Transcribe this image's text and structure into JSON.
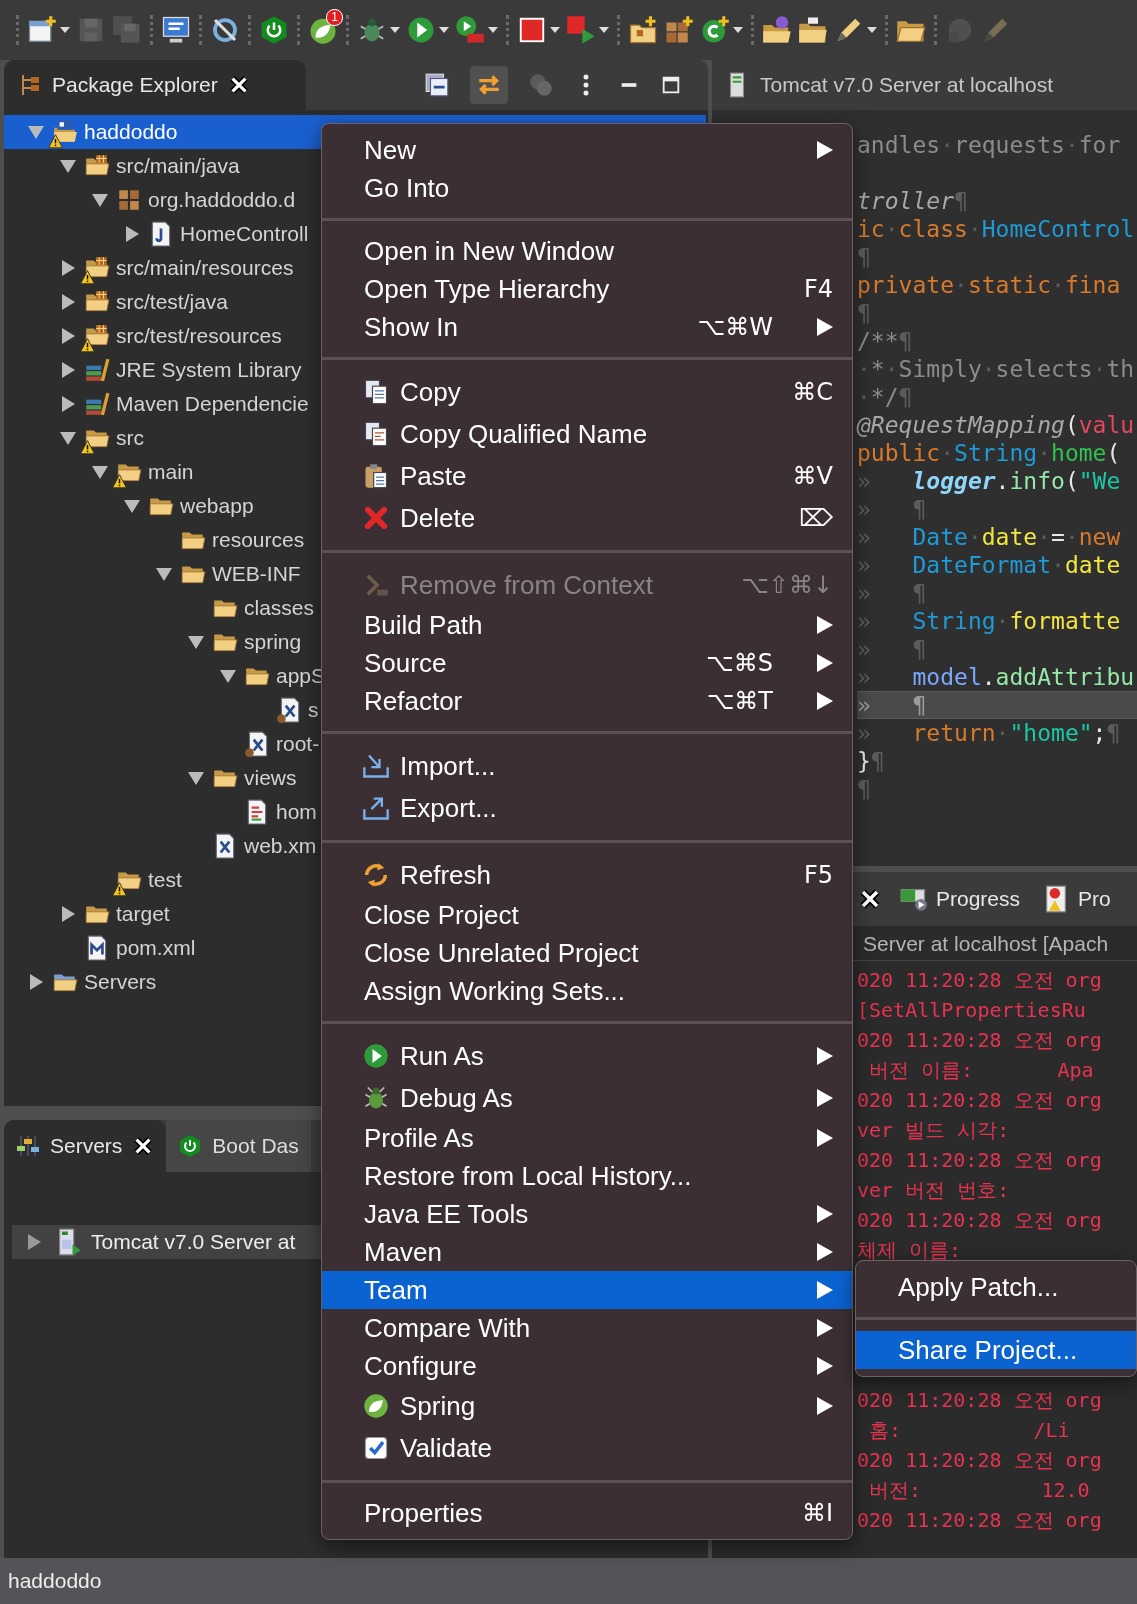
{
  "toolbar": [
    [
      {
        "kind": "new",
        "dropdown": true,
        "disabled": false
      },
      {
        "kind": "save",
        "dropdown": false,
        "disabled": true
      },
      {
        "kind": "save-all",
        "dropdown": false,
        "disabled": true
      }
    ],
    [
      {
        "kind": "monitor",
        "dropdown": false,
        "disabled": false
      }
    ],
    [
      {
        "kind": "skip",
        "dropdown": false,
        "disabled": false
      }
    ],
    [
      {
        "kind": "power",
        "dropdown": false,
        "disabled": false
      }
    ],
    [
      {
        "kind": "leaf",
        "dropdown": false,
        "disabled": false,
        "badge": "1"
      }
    ],
    [
      {
        "kind": "bug",
        "dropdown": true,
        "disabled": false
      },
      {
        "kind": "run",
        "dropdown": true,
        "disabled": false
      },
      {
        "kind": "run-server",
        "dropdown": true,
        "disabled": false
      }
    ],
    [
      {
        "kind": "stop",
        "dropdown": true,
        "disabled": false
      },
      {
        "kind": "stop-arrow",
        "dropdown": true,
        "disabled": false
      }
    ],
    [
      {
        "kind": "new-package",
        "dropdown": false,
        "disabled": false
      },
      {
        "kind": "new-grid",
        "dropdown": false,
        "disabled": false
      },
      {
        "kind": "new-class",
        "dropdown": true,
        "disabled": false
      }
    ],
    [
      {
        "kind": "folder-ball",
        "dropdown": false,
        "disabled": false
      },
      {
        "kind": "briefcase",
        "dropdown": false,
        "disabled": false
      },
      {
        "kind": "pencil",
        "dropdown": true,
        "disabled": false
      }
    ],
    [
      {
        "kind": "folder-open",
        "dropdown": false,
        "disabled": false
      }
    ],
    [
      {
        "kind": "grey-blob",
        "dropdown": false,
        "disabled": true
      },
      {
        "kind": "pencil",
        "dropdown": false,
        "disabled": true
      }
    ]
  ],
  "package_explorer": {
    "title": "Package Explorer",
    "tree": [
      {
        "label": "haddoddo",
        "kind": "project",
        "warning": true,
        "selected": true,
        "expanded": true,
        "children": [
          {
            "label": "src/main/java",
            "kind": "source-folder",
            "warning": false,
            "selected": false,
            "expanded": true,
            "children": [
              {
                "label": "org.haddoddo.d",
                "kind": "package",
                "warning": false,
                "selected": false,
                "expanded": true,
                "children": [
                  {
                    "label": "HomeControll",
                    "kind": "java",
                    "warning": false,
                    "selected": false,
                    "expanded": false
                  }
                ]
              }
            ]
          },
          {
            "label": "src/main/resources",
            "kind": "source-folder",
            "warning": true,
            "selected": false,
            "expanded": false
          },
          {
            "label": "src/test/java",
            "kind": "source-folder",
            "warning": false,
            "selected": false,
            "expanded": false
          },
          {
            "label": "src/test/resources",
            "kind": "source-folder",
            "warning": true,
            "selected": false,
            "expanded": false
          },
          {
            "label": "JRE System Library",
            "kind": "library",
            "warning": false,
            "selected": false,
            "expanded": false
          },
          {
            "label": "Maven Dependencie",
            "kind": "library",
            "warning": false,
            "selected": false,
            "expanded": false
          },
          {
            "label": "src",
            "kind": "folder",
            "warning": true,
            "selected": false,
            "expanded": true,
            "children": [
              {
                "label": "main",
                "kind": "folder",
                "warning": true,
                "selected": false,
                "expanded": true,
                "children": [
                  {
                    "label": "webapp",
                    "kind": "folder",
                    "warning": false,
                    "selected": false,
                    "expanded": true,
                    "children": [
                      {
                        "label": "resources",
                        "kind": "folder",
                        "warning": false,
                        "selected": false
                      },
                      {
                        "label": "WEB-INF",
                        "kind": "folder",
                        "warning": false,
                        "selected": false,
                        "expanded": true,
                        "children": [
                          {
                            "label": "classes",
                            "kind": "folder",
                            "warning": false,
                            "selected": false
                          },
                          {
                            "label": "spring",
                            "kind": "folder",
                            "warning": false,
                            "selected": false,
                            "expanded": true,
                            "children": [
                              {
                                "label": "appS",
                                "kind": "folder",
                                "warning": false,
                                "selected": false,
                                "expanded": true,
                                "children": [
                                  {
                                    "label": "s",
                                    "kind": "xml-spring",
                                    "warning": false,
                                    "selected": false
                                  }
                                ]
                              },
                              {
                                "label": "root-",
                                "kind": "xml-spring",
                                "warning": false,
                                "selected": false
                              }
                            ]
                          },
                          {
                            "label": "views",
                            "kind": "folder",
                            "warning": false,
                            "selected": false,
                            "expanded": true,
                            "children": [
                              {
                                "label": "hom",
                                "kind": "jsp",
                                "warning": false,
                                "selected": false
                              }
                            ]
                          },
                          {
                            "label": "web.xm",
                            "kind": "xml",
                            "warning": false,
                            "selected": false
                          }
                        ]
                      }
                    ]
                  }
                ]
              },
              {
                "label": "test",
                "kind": "folder",
                "warning": true,
                "selected": false
              }
            ]
          },
          {
            "label": "target",
            "kind": "folder",
            "warning": false,
            "selected": false,
            "expanded": false
          },
          {
            "label": "pom.xml",
            "kind": "maven",
            "warning": false,
            "selected": false
          }
        ]
      },
      {
        "label": "Servers",
        "kind": "server-folder",
        "warning": false,
        "selected": false,
        "expanded": false
      }
    ]
  },
  "editor": {
    "tab": "Tomcat v7.0 Server at localhost",
    "lines": [
      {
        "current": false,
        "tokens": [
          {
            "text": "andles·requests·for",
            "kind": "comment"
          }
        ]
      },
      {
        "current": false,
        "tokens": [
          {
            "text": "troller",
            "kind": "annotation"
          },
          {
            "text": "¶",
            "kind": "plain"
          }
        ]
      },
      {
        "current": false,
        "tokens": [
          {
            "text": "ic·class·",
            "kind": "keyword"
          },
          {
            "text": "HomeControl",
            "kind": "type"
          }
        ]
      },
      {
        "current": false,
        "tokens": [
          {
            "text": "¶",
            "kind": "plain"
          }
        ]
      },
      {
        "current": false,
        "tokens": [
          {
            "text": "private·static·fina",
            "kind": "keyword"
          }
        ]
      },
      {
        "current": false,
        "tokens": [
          {
            "text": "¶",
            "kind": "plain"
          }
        ]
      },
      {
        "current": false,
        "tokens": [
          {
            "text": "/**¶",
            "kind": "comment"
          }
        ]
      },
      {
        "current": false,
        "tokens": [
          {
            "text": "·*·Simply·selects·th",
            "kind": "comment"
          }
        ]
      },
      {
        "current": false,
        "tokens": [
          {
            "text": "·*/¶",
            "kind": "comment"
          }
        ]
      },
      {
        "current": false,
        "tokens": [
          {
            "text": "@RequestMapping",
            "kind": "annotation"
          },
          {
            "text": "(",
            "kind": "plain"
          },
          {
            "text": "valu",
            "kind": "attribute"
          }
        ]
      },
      {
        "current": false,
        "tokens": [
          {
            "text": "public·",
            "kind": "keyword"
          },
          {
            "text": "String·",
            "kind": "type"
          },
          {
            "text": "home",
            "kind": "method"
          },
          {
            "text": "(",
            "kind": "plain"
          }
        ]
      },
      {
        "current": false,
        "tokens": [
          {
            "text": "»   ",
            "kind": "plain"
          },
          {
            "text": "logger",
            "kind": "field"
          },
          {
            "text": ".",
            "kind": "plain"
          },
          {
            "text": "info",
            "kind": "call"
          },
          {
            "text": "(",
            "kind": "plain"
          },
          {
            "text": "\"We",
            "kind": "string"
          }
        ]
      },
      {
        "current": false,
        "tokens": [
          {
            "text": "»   ¶",
            "kind": "plain"
          }
        ]
      },
      {
        "current": false,
        "tokens": [
          {
            "text": "»   ",
            "kind": "plain"
          },
          {
            "text": "Date·",
            "kind": "type"
          },
          {
            "text": "date",
            "kind": "local"
          },
          {
            "text": "·=·",
            "kind": "plain"
          },
          {
            "text": "new",
            "kind": "keyword"
          }
        ]
      },
      {
        "current": false,
        "tokens": [
          {
            "text": "»   ",
            "kind": "plain"
          },
          {
            "text": "DateFormat·",
            "kind": "type"
          },
          {
            "text": "date",
            "kind": "local"
          }
        ]
      },
      {
        "current": false,
        "tokens": [
          {
            "text": "»   ¶",
            "kind": "plain"
          }
        ]
      },
      {
        "current": false,
        "tokens": [
          {
            "text": "»   ",
            "kind": "plain"
          },
          {
            "text": "String·",
            "kind": "type"
          },
          {
            "text": "formatte",
            "kind": "local"
          }
        ]
      },
      {
        "current": false,
        "tokens": [
          {
            "text": "»   ¶",
            "kind": "plain"
          }
        ]
      },
      {
        "current": false,
        "tokens": [
          {
            "text": "»   ",
            "kind": "plain"
          },
          {
            "text": "model",
            "kind": "parameter"
          },
          {
            "text": ".",
            "kind": "plain"
          },
          {
            "text": "addAttribu",
            "kind": "call"
          }
        ]
      },
      {
        "current": true,
        "tokens": [
          {
            "text": "»   ¶",
            "kind": "plain"
          }
        ]
      },
      {
        "current": false,
        "tokens": [
          {
            "text": "»   ",
            "kind": "plain"
          },
          {
            "text": "return·",
            "kind": "keyword"
          },
          {
            "text": "\"home\"",
            "kind": "string"
          },
          {
            "text": ";¶",
            "kind": "plain"
          }
        ]
      },
      {
        "current": false,
        "tokens": [
          {
            "text": "}¶",
            "kind": "plain"
          }
        ]
      },
      {
        "current": false,
        "tokens": [
          {
            "text": "¶",
            "kind": "plain"
          }
        ]
      }
    ]
  },
  "servers_panel": {
    "tabs": [
      {
        "label": "Servers",
        "kind": "servers",
        "selected": true
      },
      {
        "label": "Boot Das",
        "kind": "power",
        "selected": false
      }
    ],
    "servers": [
      {
        "label": "Tomcat v7.0 Server at",
        "expanded": false,
        "selected": true
      }
    ]
  },
  "console_panel": {
    "tabs": [
      {
        "label": "Progress",
        "kind": "progress",
        "selected": false
      },
      {
        "label": "Pro",
        "kind": "problems",
        "selected": false
      }
    ],
    "header": "Server at localhost [Apach",
    "lines": [
      "020 11:20:28 오전 org",
      "[SetAllPropertiesRu",
      "020 11:20:28 오전 org",
      " 버전 이름:       Apa",
      "020 11:20:28 오전 org",
      "ver 빌드 시각:",
      "020 11:20:28 오전 org",
      "ver 버전 번호:",
      "020 11:20:28 오전 org",
      "체제 이름:",
      "020 11:20:28 오전 org",
      " 홈:           /Li",
      "020 11:20:28 오전 org",
      " 버전:          12.0",
      "020 11:20:28 오전 org"
    ]
  },
  "context_menu": {
    "sections": [
      [
        {
          "label": "New",
          "kind": "text",
          "submenu": true,
          "selected": false,
          "disabled": false
        },
        {
          "label": "Go Into",
          "kind": "text",
          "submenu": false,
          "selected": false,
          "disabled": false
        }
      ],
      [
        {
          "label": "Open in New Window",
          "kind": "text",
          "submenu": false,
          "selected": false,
          "disabled": false
        },
        {
          "label": "Open Type Hierarchy",
          "kind": "text",
          "shortcut": "F4",
          "submenu": false,
          "selected": false,
          "disabled": false
        },
        {
          "label": "Show In",
          "kind": "text",
          "shortcut": "⌥⌘W",
          "submenu": true,
          "selected": false,
          "disabled": false
        }
      ],
      [
        {
          "label": "Copy",
          "kind": "copy",
          "shortcut": "⌘C",
          "submenu": false,
          "selected": false,
          "disabled": false
        },
        {
          "label": "Copy Qualified Name",
          "kind": "copy-name",
          "submenu": false,
          "selected": false,
          "disabled": false
        },
        {
          "label": "Paste",
          "kind": "paste",
          "shortcut": "⌘V",
          "submenu": false,
          "selected": false,
          "disabled": false
        },
        {
          "label": "Delete",
          "kind": "delete",
          "shortcut": "⌦",
          "submenu": false,
          "selected": false,
          "disabled": false
        }
      ],
      [
        {
          "label": "Remove from Context",
          "kind": "remove",
          "shortcut": "⌥⇧⌘↓",
          "submenu": false,
          "selected": false,
          "disabled": true
        },
        {
          "label": "Build Path",
          "kind": "text",
          "submenu": true,
          "selected": false,
          "disabled": false
        },
        {
          "label": "Source",
          "kind": "text",
          "shortcut": "⌥⌘S",
          "submenu": true,
          "selected": false,
          "disabled": false
        },
        {
          "label": "Refactor",
          "kind": "text",
          "shortcut": "⌥⌘T",
          "submenu": true,
          "selected": false,
          "disabled": false
        }
      ],
      [
        {
          "label": "Import...",
          "kind": "import",
          "submenu": false,
          "selected": false,
          "disabled": false
        },
        {
          "label": "Export...",
          "kind": "export",
          "submenu": false,
          "selected": false,
          "disabled": false
        }
      ],
      [
        {
          "label": "Refresh",
          "kind": "refresh",
          "shortcut": "F5",
          "submenu": false,
          "selected": false,
          "disabled": false
        },
        {
          "label": "Close Project",
          "kind": "text",
          "submenu": false,
          "selected": false,
          "disabled": false
        },
        {
          "label": "Close Unrelated Project",
          "kind": "text",
          "submenu": false,
          "selected": false,
          "disabled": false
        },
        {
          "label": "Assign Working Sets...",
          "kind": "text",
          "submenu": false,
          "selected": false,
          "disabled": false
        }
      ],
      [
        {
          "label": "Run As",
          "kind": "run",
          "submenu": true,
          "selected": false,
          "disabled": false
        },
        {
          "label": "Debug As",
          "kind": "debug",
          "submenu": true,
          "selected": false,
          "disabled": false
        },
        {
          "label": "Profile As",
          "kind": "text",
          "submenu": true,
          "selected": false,
          "disabled": false
        },
        {
          "label": "Restore from Local History...",
          "kind": "text",
          "submenu": false,
          "selected": false,
          "disabled": false
        },
        {
          "label": "Java EE Tools",
          "kind": "text",
          "submenu": true,
          "selected": false,
          "disabled": false
        },
        {
          "label": "Maven",
          "kind": "text",
          "submenu": true,
          "selected": false,
          "disabled": false
        },
        {
          "label": "Team",
          "kind": "text",
          "submenu": true,
          "selected": true,
          "disabled": false
        },
        {
          "label": "Compare With",
          "kind": "text",
          "submenu": true,
          "selected": false,
          "disabled": false
        },
        {
          "label": "Configure",
          "kind": "text",
          "submenu": true,
          "selected": false,
          "disabled": false
        },
        {
          "label": "Spring",
          "kind": "spring",
          "submenu": true,
          "selected": false,
          "disabled": false
        },
        {
          "label": "Validate",
          "kind": "validate",
          "submenu": false,
          "selected": false,
          "disabled": false
        }
      ],
      [
        {
          "label": "Properties",
          "kind": "text",
          "shortcut": "⌘I",
          "submenu": false,
          "selected": false,
          "disabled": false
        }
      ]
    ]
  },
  "submenu": {
    "sections": [
      [
        {
          "label": "Apply Patch...",
          "submenu": false,
          "selected": false,
          "disabled": false
        }
      ],
      [
        {
          "label": "Share Project...",
          "submenu": false,
          "selected": true,
          "disabled": false
        }
      ]
    ]
  },
  "status_bar": "haddoddo"
}
